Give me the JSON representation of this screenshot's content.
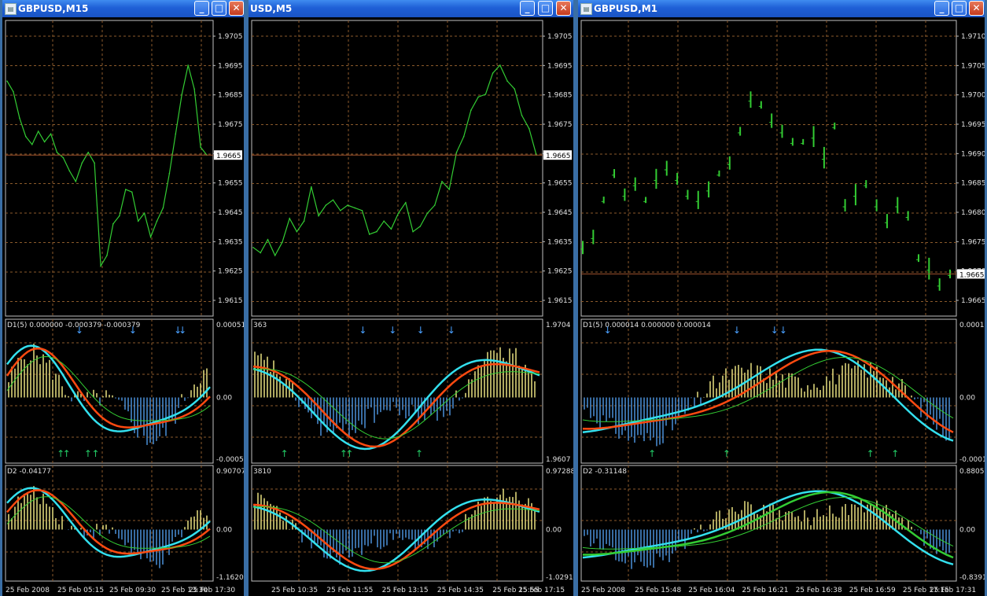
{
  "windows": [
    {
      "title": "GBPUSD,M15",
      "price_labels": [
        "1.9705",
        "1.9695",
        "1.9685",
        "1.9675",
        "1.9665",
        "1.9655",
        "1.9645",
        "1.9635",
        "1.9625",
        "1.9615"
      ],
      "current_price": "1.9665",
      "ind1": {
        "label": "D1(5) 0.000000 -0.000379 -0.000379",
        "top": "0.00051",
        "zero": "0.00",
        "bottom": "-0.00051"
      },
      "ind2": {
        "label": "D2 -0.04177",
        "top": "0.90707",
        "zero": "0.00",
        "bottom": "-1.16202"
      },
      "time_labels": [
        "25 Feb 2008",
        "25 Feb 05:15",
        "25 Feb 09:30",
        "25 Feb 13:30",
        "25 Feb 17:30"
      ]
    },
    {
      "title": "USD,M5",
      "price_labels": [
        "1.9705",
        "1.9695",
        "1.9685",
        "1.9675",
        "1.9665",
        "1.9655",
        "1.9645",
        "1.9635",
        "1.9625",
        "1.9615"
      ],
      "current_price": "1.9665",
      "ind1": {
        "label": "363",
        "top": "1.9704",
        "zero": "",
        "bottom": "1.9607"
      },
      "ind2": {
        "label": "3810",
        "top": "0.97288",
        "zero": "0.00",
        "bottom": "-1.0291"
      },
      "time_labels": [
        "25 Feb 10:35",
        "25 Feb 11:55",
        "25 Feb 13:15",
        "25 Feb 14:35",
        "25 Feb 15:55",
        "25 Feb 17:15"
      ]
    },
    {
      "title": "GBPUSD,M1",
      "price_labels": [
        "1.9710",
        "1.9705",
        "1.9700",
        "1.9695",
        "1.9690",
        "1.9685",
        "1.9680",
        "1.9675",
        "1.9670",
        "1.9665"
      ],
      "current_price": "1.9665",
      "ind1": {
        "label": "D1(5) 0.000014 0.000000 0.000014",
        "top": "0.00017",
        "zero": "0.00",
        "bottom": "-0.00016"
      },
      "ind2": {
        "label": "D2 -0.31148",
        "top": "0.88051",
        "zero": "0.00",
        "bottom": "-0.83916"
      },
      "time_labels": [
        "25 Feb 2008",
        "25 Feb 15:48",
        "25 Feb 16:04",
        "25 Feb 16:21",
        "25 Feb 16:38",
        "25 Feb 16:59",
        "25 Feb 17:15",
        "25 Feb 17:31"
      ]
    }
  ],
  "colors": {
    "background": "#000000",
    "grid": "#8b5a2b",
    "price_line": "#33cc33",
    "current_price_line": "#a0522d",
    "hist_positive": "#e8e080",
    "hist_negative": "#4a90d9",
    "signal_cyan": "#33e0ee",
    "signal_red": "#ff4a10",
    "signal_green": "#33cc33",
    "arrow_down": "#4aa0ff",
    "arrow_up": "#22cc66"
  },
  "chart_data": [
    {
      "type": "line",
      "title": "GBPUSD,M15",
      "ylim": [
        1.961,
        1.971
      ],
      "series": [
        {
          "values": [
            1.9693,
            1.9689,
            1.9679,
            1.9672,
            1.9669,
            1.9674,
            1.967,
            1.9673,
            1.9666,
            1.9664,
            1.9659,
            1.9655,
            1.9662,
            1.9666,
            1.9662,
            1.9623,
            1.9627,
            1.9639,
            1.9642,
            1.9652,
            1.9651,
            1.964,
            1.9643,
            1.9634,
            1.964,
            1.9645,
            1.9658,
            1.9673,
            1.9688,
            1.9699,
            1.969,
            1.9668,
            1.9665
          ]
        }
      ]
    },
    {
      "type": "line",
      "title": "USD,M5",
      "ylim": [
        1.961,
        1.971
      ],
      "series": [
        {
          "values": [
            1.963,
            1.9628,
            1.9633,
            1.9627,
            1.9632,
            1.9641,
            1.9636,
            1.964,
            1.9653,
            1.9642,
            1.9646,
            1.9648,
            1.9644,
            1.9646,
            1.9645,
            1.9644,
            1.9635,
            1.9636,
            1.964,
            1.9637,
            1.9643,
            1.9647,
            1.9636,
            1.9638,
            1.9643,
            1.9646,
            1.9655,
            1.9652,
            1.9666,
            1.9672,
            1.9682,
            1.9687,
            1.9688,
            1.9696,
            1.9699,
            1.9693,
            1.969,
            1.968,
            1.9675,
            1.9665
          ]
        }
      ]
    },
    {
      "type": "bar",
      "title": "GBPUSD,M1",
      "ylim": [
        1.966,
        1.971
      ],
      "series": [
        {
          "values": [
            1.967,
            1.9672,
            1.9679,
            1.9684,
            1.968,
            1.9682,
            1.9679,
            1.9683,
            1.9685,
            1.9683,
            1.968,
            1.9679,
            1.9681,
            1.9684,
            1.9686,
            1.9692,
            1.9698,
            1.9697,
            1.9694,
            1.9692,
            1.969,
            1.969,
            1.9691,
            1.9687,
            1.9693,
            1.9678,
            1.968,
            1.9682,
            1.9678,
            1.9675,
            1.9678,
            1.9676,
            1.9668,
            1.9666,
            1.9663,
            1.9665
          ]
        }
      ]
    }
  ]
}
